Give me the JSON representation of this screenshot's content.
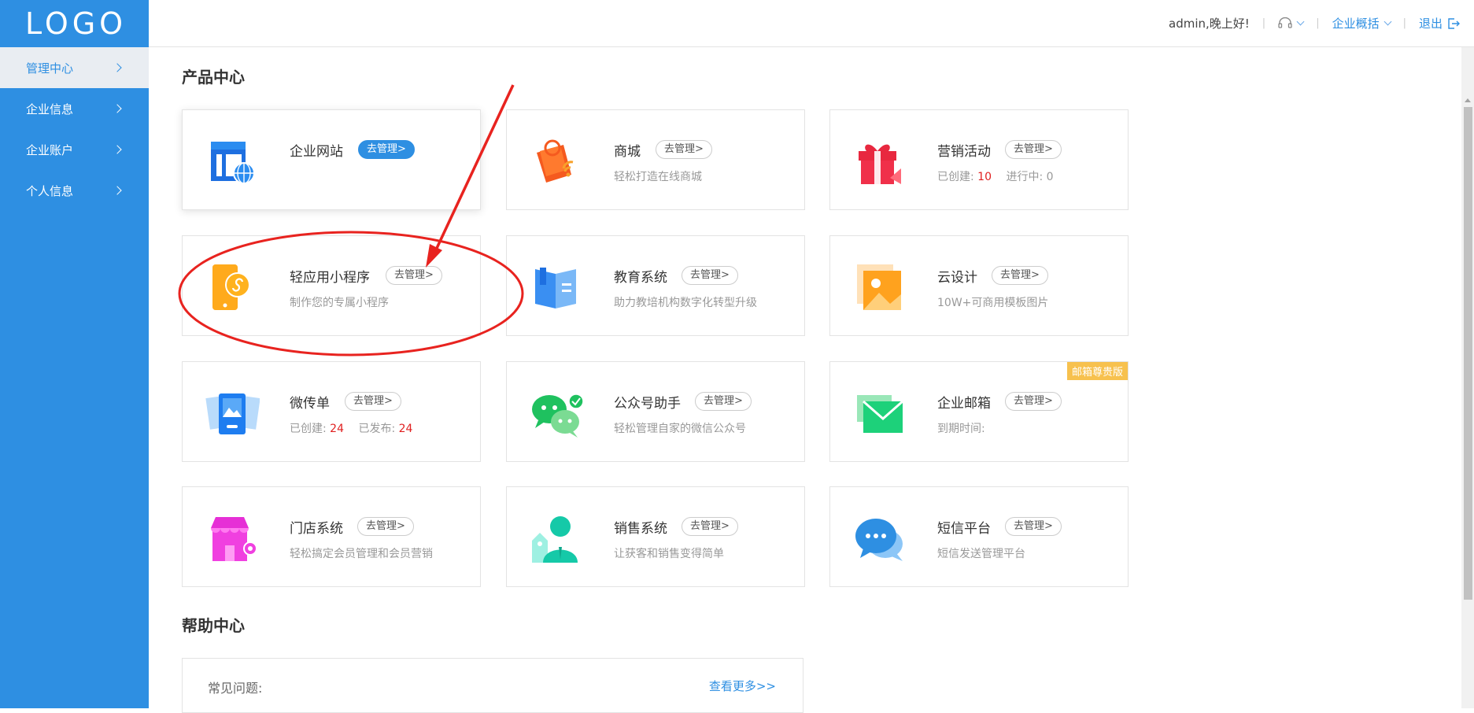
{
  "sidebar": {
    "logo": "LOGO",
    "items": [
      {
        "label": "管理中心"
      },
      {
        "label": "企业信息"
      },
      {
        "label": "企业账户"
      },
      {
        "label": "个人信息"
      }
    ]
  },
  "header": {
    "greeting": "admin,晚上好!",
    "overview_label": "企业概括",
    "logout_label": "退出"
  },
  "products": {
    "title": "产品中心",
    "cards": [
      {
        "name": "企业网站",
        "manage": "去管理>",
        "desc": ""
      },
      {
        "name": "商城",
        "manage": "去管理>",
        "desc": "轻松打造在线商城"
      },
      {
        "name": "营销活动",
        "manage": "去管理>",
        "created_label": "已创建:",
        "created": "10",
        "ongoing_label": "进行中:",
        "ongoing": "0"
      },
      {
        "name": "轻应用小程序",
        "manage": "去管理>",
        "desc": "制作您的专属小程序"
      },
      {
        "name": "教育系统",
        "manage": "去管理>",
        "desc": "助力教培机构数字化转型升级"
      },
      {
        "name": "云设计",
        "manage": "去管理>",
        "desc": "10W+可商用模板图片"
      },
      {
        "name": "微传单",
        "manage": "去管理>",
        "created_label": "已创建:",
        "created": "24",
        "published_label": "已发布:",
        "published": "24"
      },
      {
        "name": "公众号助手",
        "manage": "去管理>",
        "desc": "轻松管理自家的微信公众号"
      },
      {
        "name": "企业邮箱",
        "manage": "去管理>",
        "desc": "到期时间:",
        "badge": "邮箱尊贵版"
      },
      {
        "name": "门店系统",
        "manage": "去管理>",
        "desc": "轻松搞定会员管理和会员营销"
      },
      {
        "name": "销售系统",
        "manage": "去管理>",
        "desc": "让获客和销售变得简单"
      },
      {
        "name": "短信平台",
        "manage": "去管理>",
        "desc": "短信发送管理平台"
      }
    ]
  },
  "help": {
    "title": "帮助中心",
    "faq_label": "常见问题:",
    "more_label": "查看更多>>"
  },
  "colors": {
    "primary": "#2e8fe2",
    "annotation": "#e8231f",
    "badge": "#f7c14e"
  }
}
